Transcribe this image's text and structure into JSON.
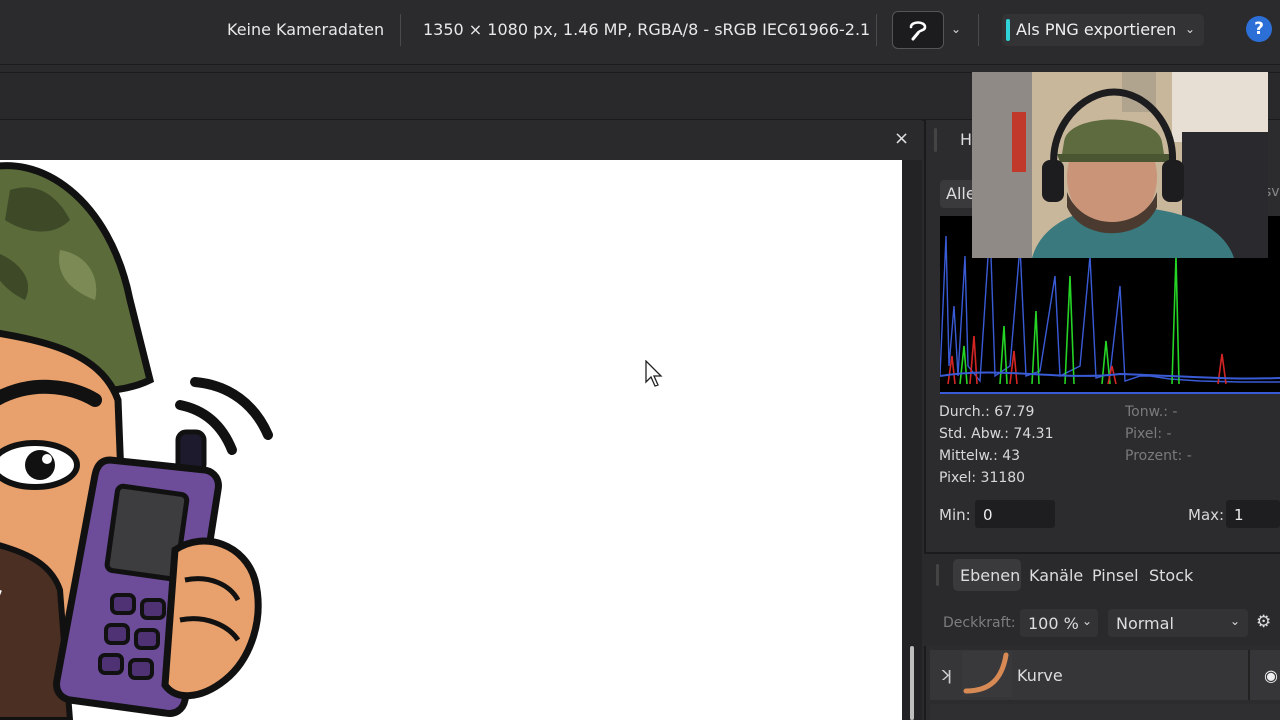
{
  "topbar": {
    "camera_info": "Keine Kameradaten",
    "image_info": "1350 × 1080 px, 1.46 MP, RGBA/8 - sRGB IEC61966-2.1",
    "export_label": "Als PNG exportieren",
    "help_label": "?",
    "tool_icon": "refine-brush-icon"
  },
  "document": {
    "close_label": "×"
  },
  "histogram_panel": {
    "tab_label": "H",
    "channel_button": "Alle",
    "partial_label": "sv",
    "stats_left": [
      "Durch.: 67.79",
      "Std. Abw.: 74.31",
      "Mittelw.: 43",
      "Pixel: 31180"
    ],
    "stats_right": [
      "Tonw.: -",
      "Pixel: -",
      "Prozent: -"
    ],
    "min_label": "Min:",
    "min_value": "0",
    "max_label": "Max:",
    "max_value": "1"
  },
  "layers_panel": {
    "tabs": [
      "Ebenen",
      "Kanäle",
      "Pinsel",
      "Stock"
    ],
    "active_tab": "Ebenen",
    "opacity_label": "Deckkraft:",
    "opacity_value": "100 %",
    "blend_mode": "Normal",
    "layers": [
      {
        "name": "Kurve"
      }
    ]
  },
  "colors": {
    "accent": "#2fd3d8",
    "help": "#2c6fd6",
    "histogram_blue": "#3a5bd6",
    "histogram_green": "#25d425",
    "histogram_red": "#d42525"
  }
}
